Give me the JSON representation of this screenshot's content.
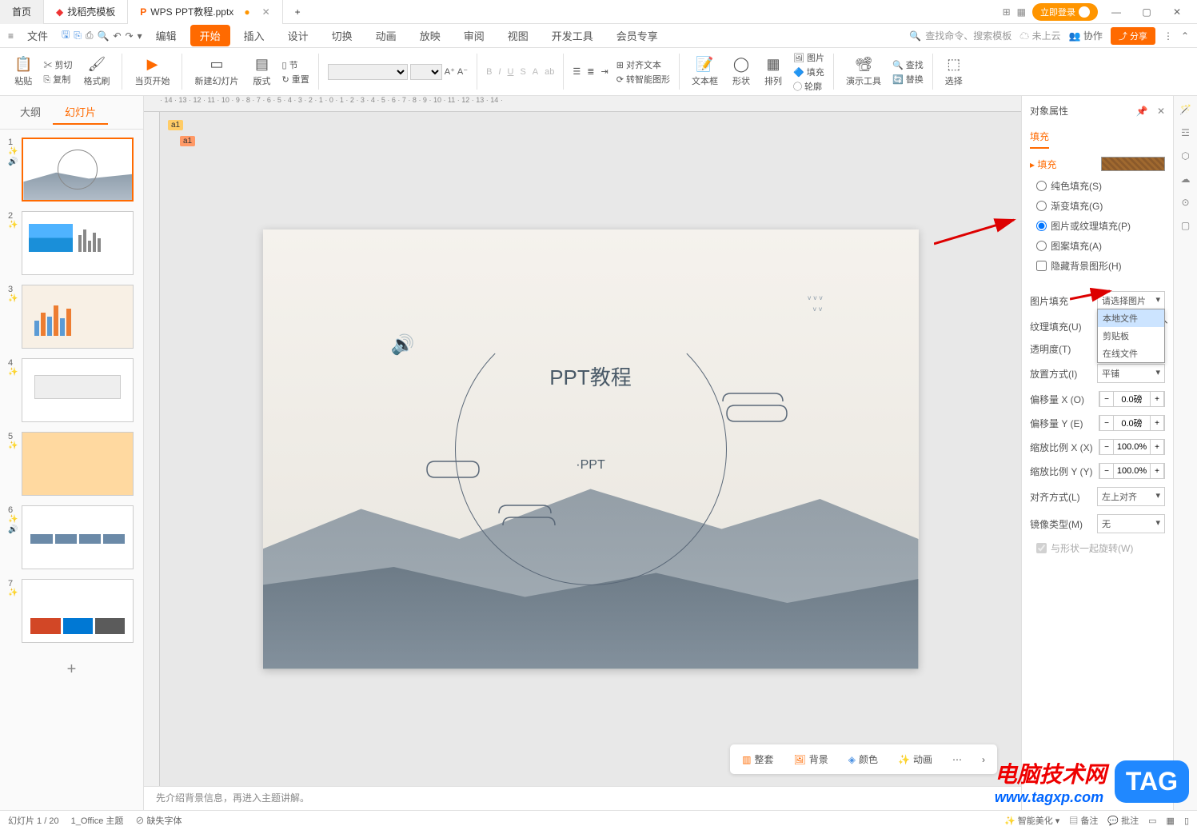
{
  "titlebar": {
    "home_tab": "首页",
    "template_tab": "找稻壳模板",
    "file_tab": "WPS PPT教程.pptx",
    "login": "立即登录"
  },
  "menubar": {
    "file": "文件",
    "edit": "编辑",
    "start": "开始",
    "insert": "插入",
    "design": "设计",
    "transition": "切换",
    "animation": "动画",
    "slideshow": "放映",
    "review": "审阅",
    "view": "视图",
    "dev": "开发工具",
    "member": "会员专享",
    "search_placeholder": "查找命令、搜索模板",
    "cloud": "未上云",
    "coop": "协作",
    "share": "分享"
  },
  "ribbon": {
    "paste": "粘贴",
    "cut": "剪切",
    "copy": "复制",
    "format_painter": "格式刷",
    "from_current": "当页开始",
    "new_slide": "新建幻灯片",
    "layout": "版式",
    "section": "节",
    "reset": "重置",
    "align_text": "对齐文本",
    "smart_graphic": "转智能图形",
    "textbox": "文本框",
    "shape": "形状",
    "arrange": "排列",
    "picture": "图片",
    "fill": "填充",
    "outline": "轮廓",
    "demo_tool": "演示工具",
    "find": "查找",
    "replace": "替换",
    "select": "选择"
  },
  "slidepanel": {
    "outline": "大纲",
    "slides": "幻灯片"
  },
  "slide": {
    "title": "PPT教程",
    "subtitle": "·PPT",
    "comment1": "a1",
    "comment2": "a1"
  },
  "canvas_toolbar": {
    "suite": "整套",
    "background": "背景",
    "color": "颜色",
    "animation": "动画"
  },
  "notes": "先介绍背景信息，再进入主题讲解。",
  "properties": {
    "title": "对象属性",
    "tab_fill": "填充",
    "section_fill": "填充",
    "solid_fill": "纯色填充(S)",
    "gradient_fill": "渐变填充(G)",
    "picture_fill": "图片或纹理填充(P)",
    "pattern_fill": "图案填充(A)",
    "hide_bg": "隐藏背景图形(H)",
    "pic_fill_label": "图片填充",
    "select_pic": "请选择图片",
    "local_file": "本地文件",
    "clipboard": "剪贴板",
    "online_file": "在线文件",
    "texture_fill": "纹理填充(U)",
    "transparency": "透明度(T)",
    "placement": "放置方式(I)",
    "tile": "平铺",
    "offset_x": "偏移量 X (O)",
    "offset_y": "偏移量 Y (E)",
    "scale_x": "缩放比例 X (X)",
    "scale_y": "缩放比例 Y (Y)",
    "offset_val": "0.0磅",
    "scale_val": "100.0%",
    "align": "对齐方式(L)",
    "align_val": "左上对齐",
    "mirror": "镜像类型(M)",
    "mirror_val": "无",
    "rotate": "与形状一起旋转(W)"
  },
  "statusbar": {
    "slide_num": "幻灯片 1 / 20",
    "theme": "1_Office 主题",
    "font_missing": "缺失字体",
    "smart_beautify": "智能美化",
    "notes": "备注",
    "comments": "批注"
  },
  "watermark": {
    "cn": "电脑技术网",
    "url": "www.tagxp.com",
    "tag": "TAG"
  }
}
